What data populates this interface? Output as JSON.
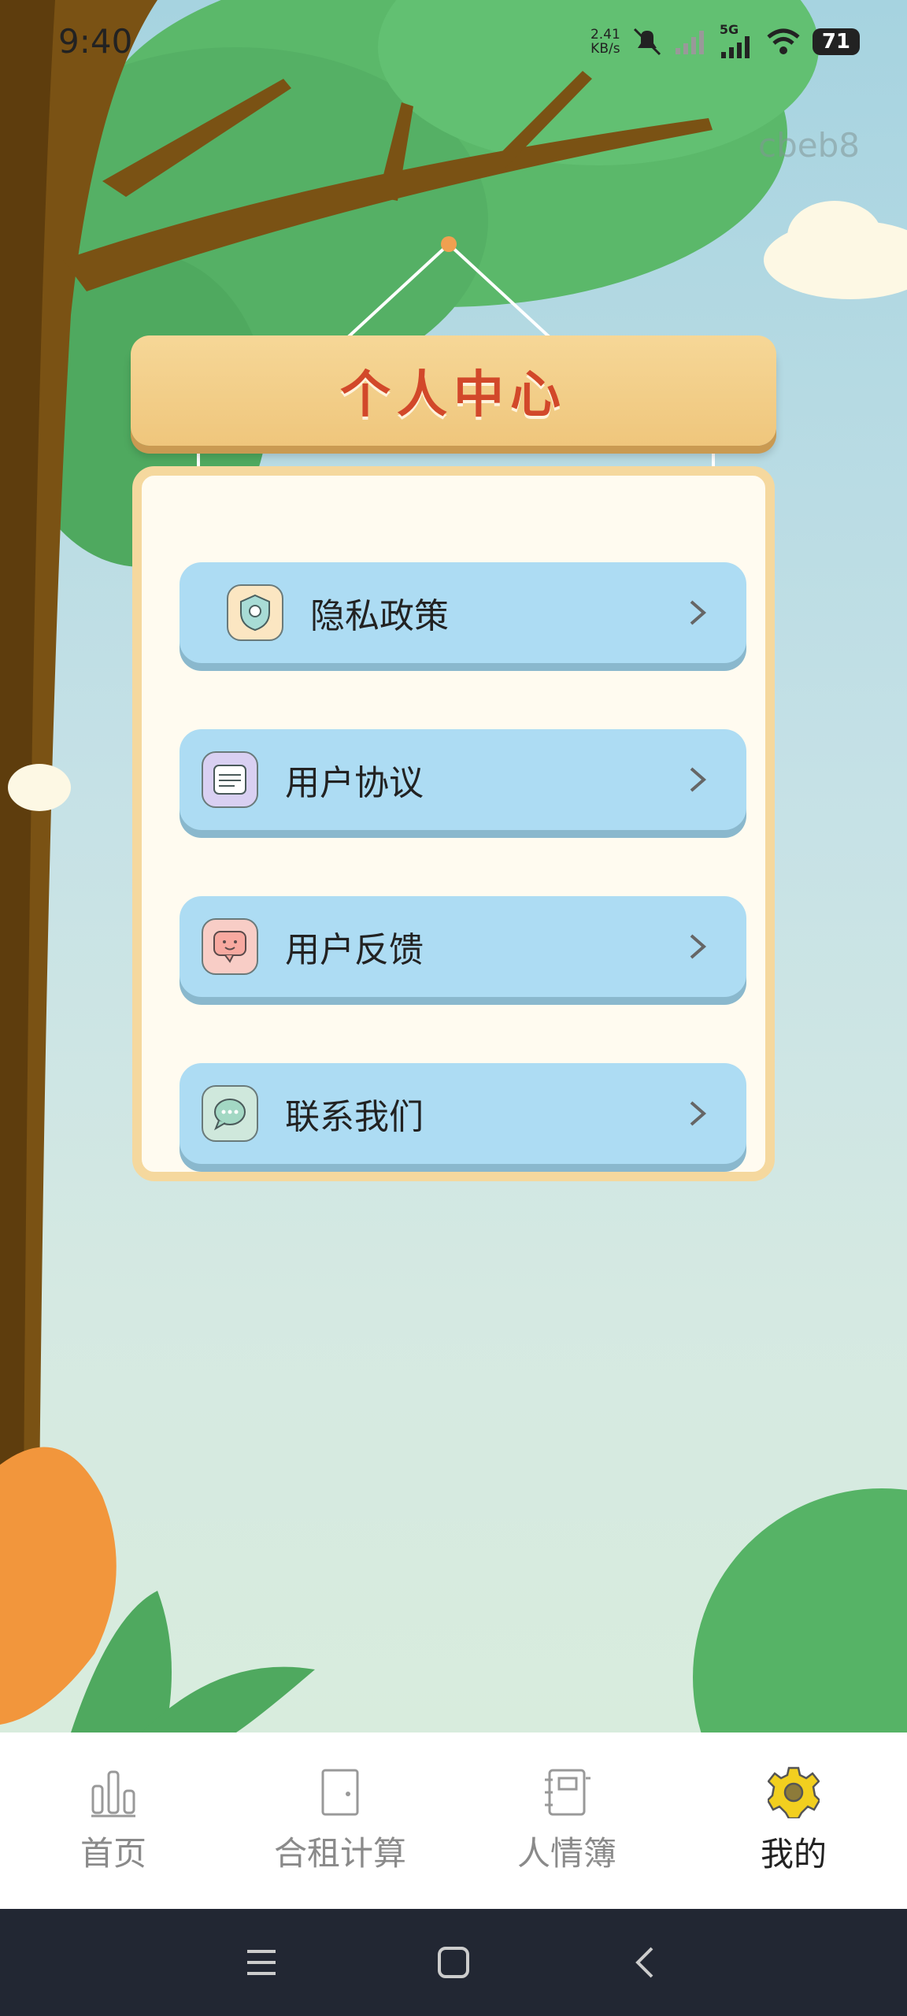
{
  "status": {
    "time": "9:40",
    "net_speed_value": "2.41",
    "net_speed_unit": "KB/s",
    "network": "5G",
    "battery": "71"
  },
  "corner_text": "cbeb8",
  "title": "个人中心",
  "menu": [
    {
      "label": "隐私政策",
      "icon": "shield-icon"
    },
    {
      "label": "用户协议",
      "icon": "document-icon"
    },
    {
      "label": "用户反馈",
      "icon": "feedback-icon"
    },
    {
      "label": "联系我们",
      "icon": "chat-icon"
    }
  ],
  "nav": [
    {
      "label": "首页",
      "icon": "bar-chart-icon"
    },
    {
      "label": "合租计算",
      "icon": "door-icon"
    },
    {
      "label": "人情簿",
      "icon": "notebook-icon"
    },
    {
      "label": "我的",
      "icon": "gear-icon",
      "active": true
    }
  ],
  "colors": {
    "menu_bg": "#addcf3",
    "title": "#d2482a",
    "active_gear": "#f2cf1f",
    "board": "#f6d797"
  }
}
